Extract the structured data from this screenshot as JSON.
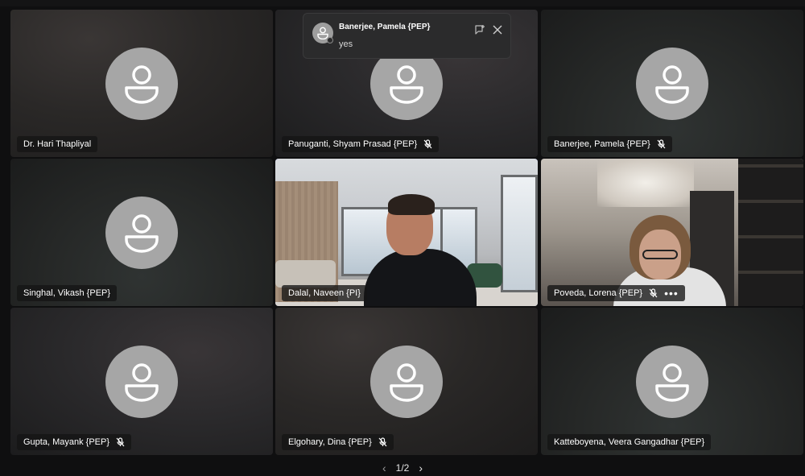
{
  "toast": {
    "sender": "Banerjee, Pamela {PEP}",
    "message": "yes"
  },
  "participants": [
    {
      "name": "Dr. Hari Thapliyal",
      "muted": false
    },
    {
      "name": "Panuganti, Shyam Prasad {PEP}",
      "muted": true
    },
    {
      "name": "Banerjee, Pamela {PEP}",
      "muted": true
    },
    {
      "name": "Singhal, Vikash {PEP}",
      "muted": false
    },
    {
      "name": "Dalal, Naveen {PI}",
      "muted": false,
      "video": true,
      "active_speaker": true
    },
    {
      "name": "Poveda, Lorena {PEP}",
      "muted": true,
      "video": true
    },
    {
      "name": "Gupta, Mayank {PEP}",
      "muted": true
    },
    {
      "name": "Elgohary, Dina {PEP}",
      "muted": true
    },
    {
      "name": "Katteboyena, Veera Gangadhar {PEP}",
      "muted": false
    }
  ],
  "more_label": "•••",
  "pager": {
    "prev": "‹",
    "label": "1/2",
    "next": "›"
  },
  "colors": {
    "active_border": "#7f85f5",
    "avatar": "#a6a6a6"
  }
}
